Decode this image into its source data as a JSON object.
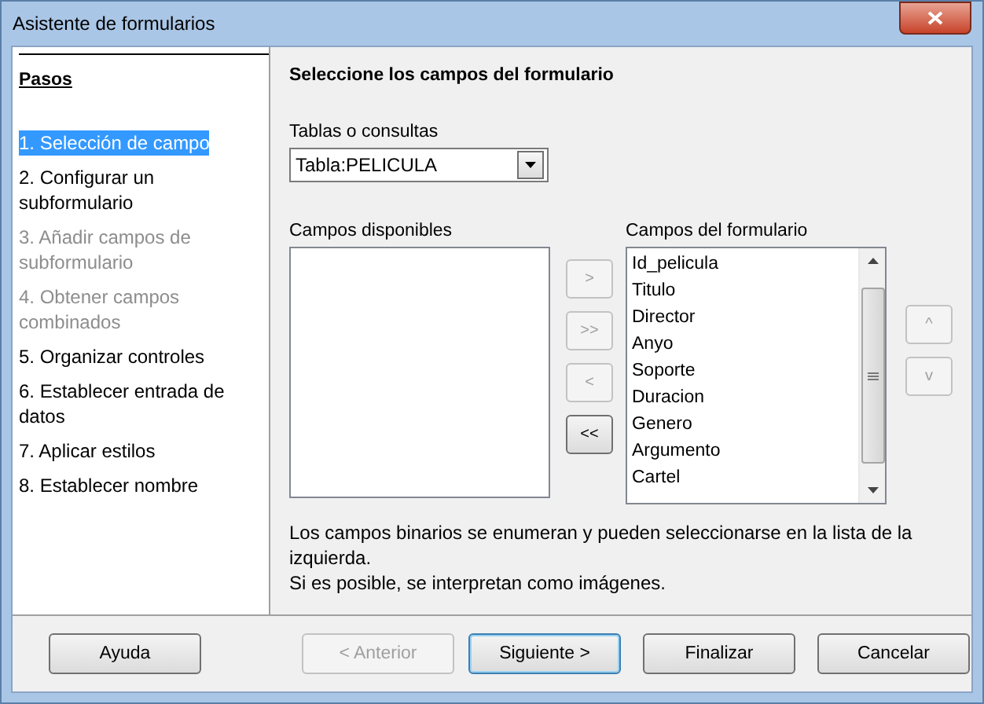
{
  "window": {
    "title": "Asistente de formularios"
  },
  "sidebar": {
    "title": "Pasos",
    "items": [
      {
        "label": "1. Selección de campo",
        "selected": true,
        "disabled": false
      },
      {
        "label": "2. Configurar un subformulario",
        "selected": false,
        "disabled": false
      },
      {
        "label": "3. Añadir campos de subformulario",
        "selected": false,
        "disabled": true
      },
      {
        "label": "4. Obtener campos combinados",
        "selected": false,
        "disabled": true
      },
      {
        "label": "5. Organizar controles",
        "selected": false,
        "disabled": false
      },
      {
        "label": "6. Establecer entrada de datos",
        "selected": false,
        "disabled": false
      },
      {
        "label": "7. Aplicar estilos",
        "selected": false,
        "disabled": false
      },
      {
        "label": "8. Establecer nombre",
        "selected": false,
        "disabled": false
      }
    ]
  },
  "main": {
    "heading": "Seleccione los campos del formulario",
    "tables_label": "Tablas o consultas",
    "tables_value": "Tabla:PELICULA",
    "available_label": "Campos disponibles",
    "move_buttons": [
      {
        "label": ">",
        "disabled": true
      },
      {
        "label": ">>",
        "disabled": true
      },
      {
        "label": "<",
        "disabled": true
      },
      {
        "label": "<<",
        "disabled": false
      }
    ],
    "form_label": "Campos del formulario",
    "form_fields": [
      "Id_pelicula",
      "Titulo",
      "Director",
      "Anyo",
      "Soporte",
      "Duracion",
      "Genero",
      "Argumento",
      "Cartel"
    ],
    "order_buttons": [
      {
        "label": "^",
        "disabled": true
      },
      {
        "label": "v",
        "disabled": true
      }
    ],
    "info": [
      "Los campos binarios se enumeran y pueden seleccionarse en la lista de la izquierda.",
      "Si es posible, se interpretan como imágenes."
    ]
  },
  "buttons": [
    {
      "label": "Ayuda",
      "disabled": false,
      "default": false
    },
    {
      "label": "< Anterior",
      "disabled": true,
      "default": false
    },
    {
      "label": "Siguiente >",
      "disabled": false,
      "default": true
    },
    {
      "label": "Finalizar",
      "disabled": false,
      "default": false
    },
    {
      "label": "Cancelar",
      "disabled": false,
      "default": false
    }
  ]
}
